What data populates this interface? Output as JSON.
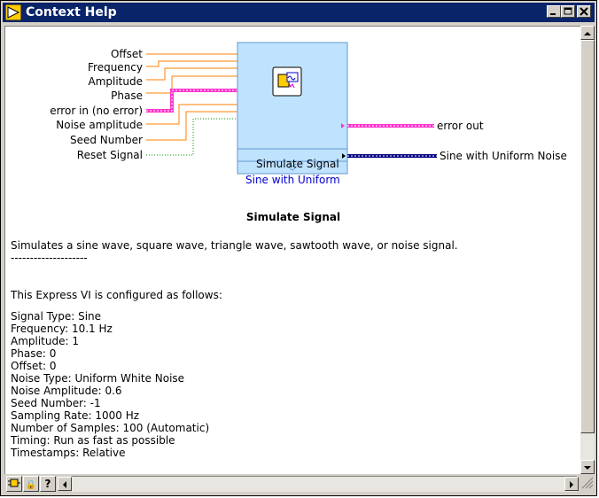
{
  "window": {
    "title": "Context Help"
  },
  "diagram": {
    "inputs": [
      "Offset",
      "Frequency",
      "Amplitude",
      "Phase",
      "error in (no error)",
      "Noise amplitude",
      "Seed Number",
      "Reset Signal"
    ],
    "outputs": [
      "error out",
      "Sine with Uniform Noise"
    ],
    "vi_name": "Simulate Signal",
    "vi_config": "Sine with Uniform"
  },
  "help": {
    "title": "Simulate Signal",
    "description": "Simulates a sine wave, square wave, triangle wave, sawtooth wave, or noise signal.",
    "separator": "--------------------",
    "config_intro": "This Express VI is configured as follows:",
    "config_lines": [
      "Signal Type: Sine",
      "Frequency: 10.1 Hz",
      "Amplitude: 1",
      "Phase: 0",
      "Offset: 0",
      "Noise Type: Uniform White Noise",
      "Noise Amplitude: 0.6",
      "Seed Number: -1",
      "Sampling Rate: 1000 Hz",
      "Number of Samples: 100 (Automatic)",
      "Timing: Run as fast as possible",
      "Timestamps: Relative"
    ]
  },
  "bottom_buttons": {
    "lock_glyph": "🔒",
    "help_glyph": "?"
  },
  "colors": {
    "titlebar": "#0a246a",
    "orange_wire": "#ff8000",
    "pink_wire": "#ff33cc",
    "green_wire": "#009900",
    "blue_wire": "#000080",
    "vi_fill": "#bfe3ff"
  }
}
